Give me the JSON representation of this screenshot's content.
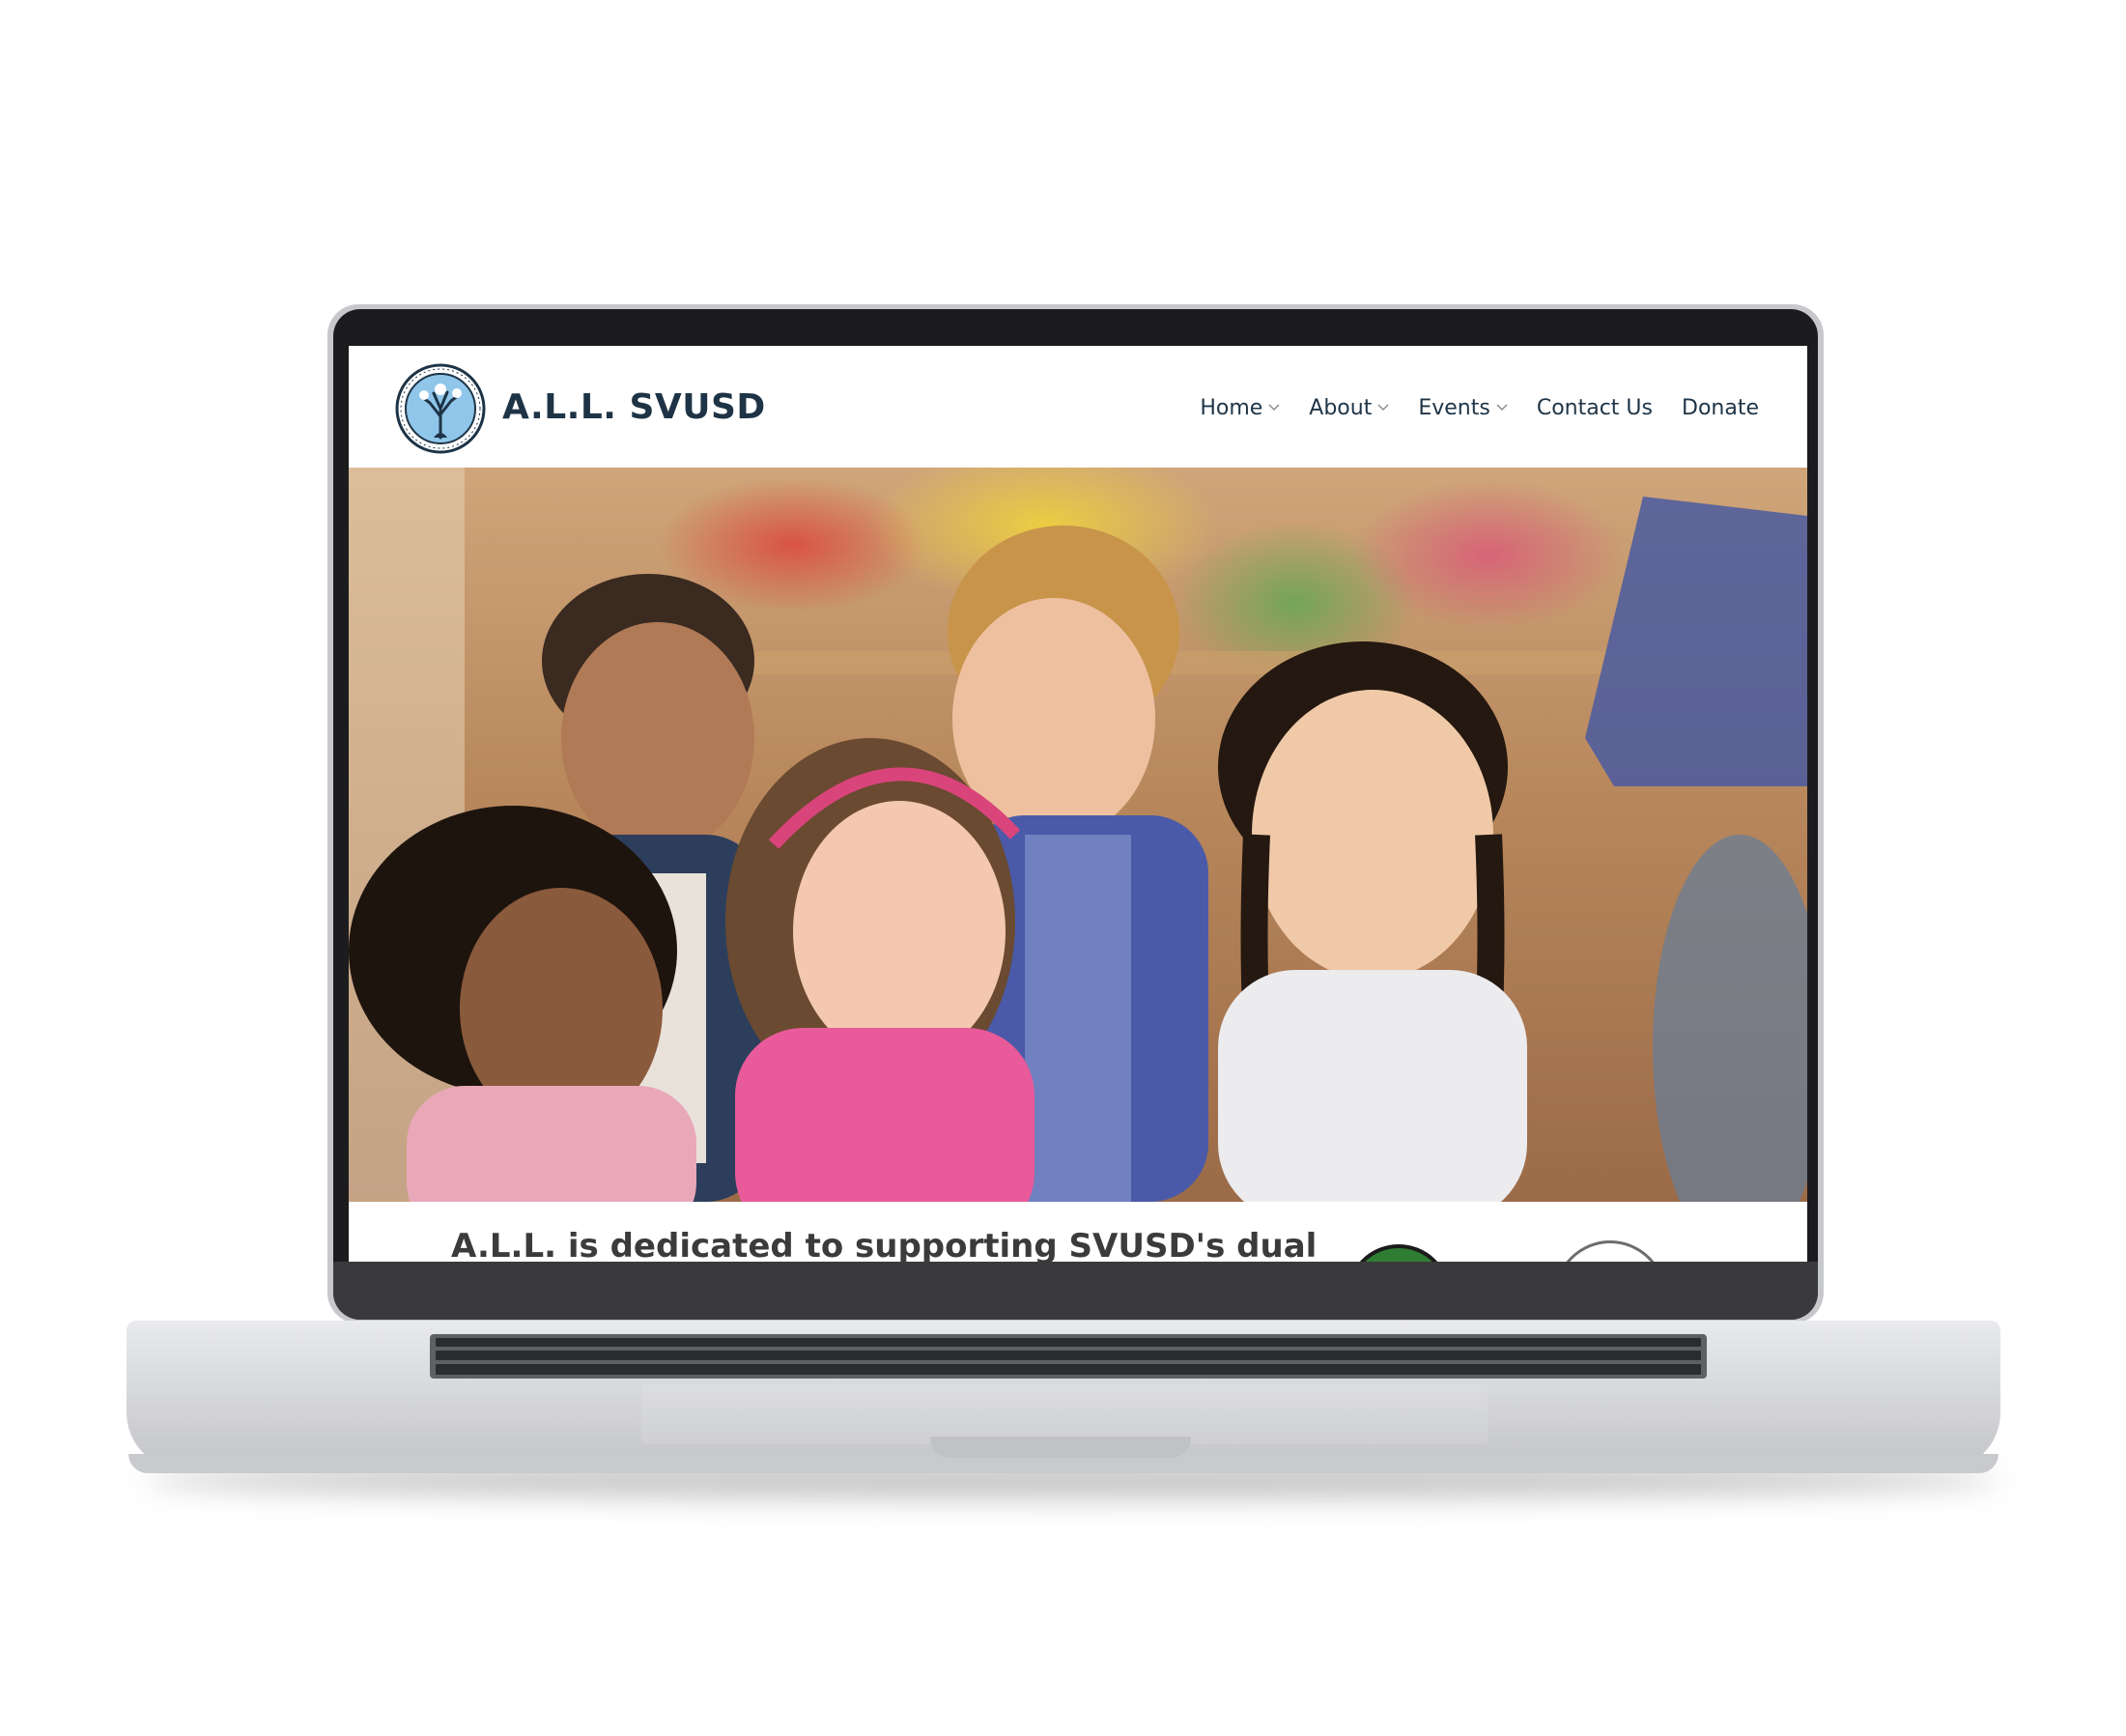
{
  "site": {
    "brand": "A.L.L. SVUSD",
    "logo_icon": "tree-logo-icon"
  },
  "nav": {
    "items": [
      {
        "label": "Home",
        "has_dropdown": true
      },
      {
        "label": "About",
        "has_dropdown": true
      },
      {
        "label": "Events",
        "has_dropdown": true
      },
      {
        "label": "Contact Us",
        "has_dropdown": false
      },
      {
        "label": "Donate",
        "has_dropdown": false
      }
    ]
  },
  "content": {
    "tagline": "A.L.L. is dedicated to supporting SVUSD's dual"
  },
  "colors": {
    "brand_text": "#1e3446",
    "body_text": "#3b3b3b"
  }
}
